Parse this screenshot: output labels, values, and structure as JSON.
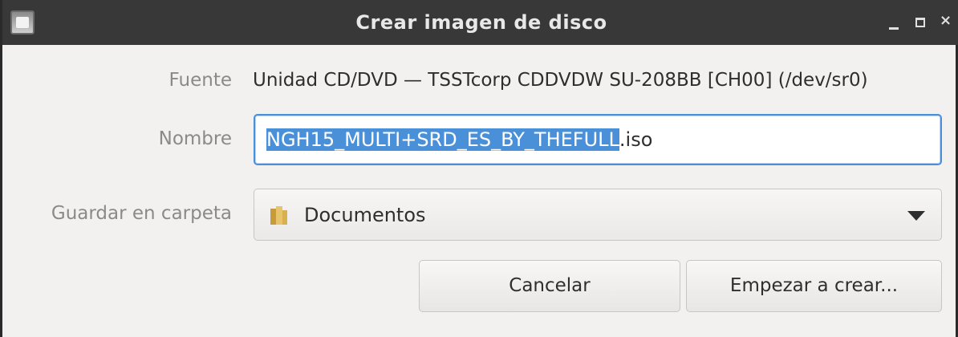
{
  "window": {
    "title": "Crear imagen de disco",
    "controls": {
      "minimize": "_",
      "maximize": "□",
      "close": "×"
    }
  },
  "form": {
    "source_label": "Fuente",
    "source_value": "Unidad CD/DVD — TSSTcorp CDDVDW SU-208BB [CH00] (/dev/sr0)",
    "name_label": "Nombre",
    "name_selected": "NGH15_MULTI+SRD_ES_BY_THEFULL",
    "name_ext": ".iso",
    "folder_label": "Guardar en carpeta",
    "folder_value": "Documentos"
  },
  "buttons": {
    "cancel": "Cancelar",
    "create": "Empezar a crear..."
  },
  "colors": {
    "titlebar": "#383838",
    "accent": "#4a90d9",
    "background": "#f2f1f0"
  },
  "icons": {
    "app": "disk-image-icon",
    "folder": "folder-icon",
    "dropdown": "chevron-down-icon"
  }
}
